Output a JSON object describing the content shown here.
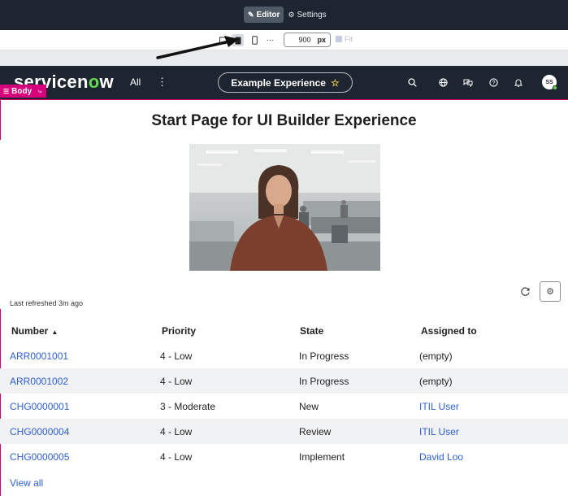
{
  "toolbar": {
    "editor_label": "Editor",
    "settings_label": "Settings",
    "width_value": "900",
    "width_unit": "px",
    "fit_label": "Fit",
    "more_label": "···"
  },
  "header": {
    "logo_text_a": "servicen",
    "logo_text_o": "o",
    "logo_text_b": "w",
    "all_label": "All",
    "experience_name": "Example Experience",
    "avatar_initials": "SS",
    "star_glyph": "☆"
  },
  "canvas": {
    "body_chip": "Body",
    "page_title": "Start Page for UI Builder Experience"
  },
  "list": {
    "last_refreshed": "Last refreshed 3m ago",
    "columns": [
      "Number",
      "Priority",
      "State",
      "Assigned to"
    ],
    "sort_indicator": "▲",
    "rows": [
      {
        "number": "ARR0001001",
        "priority": "4 - Low",
        "state": "In Progress",
        "assigned": "(empty)",
        "assigned_link": false
      },
      {
        "number": "ARR0001002",
        "priority": "4 - Low",
        "state": "In Progress",
        "assigned": "(empty)",
        "assigned_link": false
      },
      {
        "number": "CHG0000001",
        "priority": "3 - Moderate",
        "state": "New",
        "assigned": "ITIL User",
        "assigned_link": true
      },
      {
        "number": "CHG0000004",
        "priority": "4 - Low",
        "state": "Review",
        "assigned": "ITIL User",
        "assigned_link": true
      },
      {
        "number": "CHG0000005",
        "priority": "4 - Low",
        "state": "Implement",
        "assigned": "David Loo",
        "assigned_link": true
      }
    ],
    "view_all": "View all"
  },
  "colors": {
    "header_bg": "#1d2530",
    "selection": "#d6007c",
    "link": "#2d5fd1",
    "logo_accent": "#62d84e"
  }
}
